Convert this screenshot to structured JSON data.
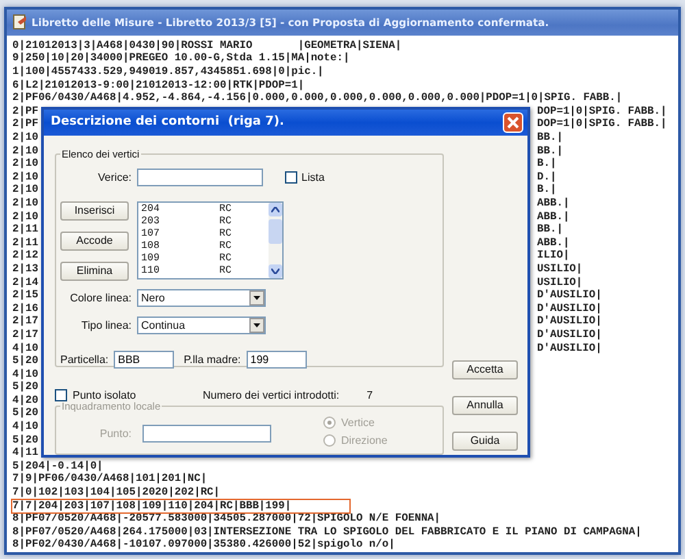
{
  "window": {
    "title": "Libretto delle Misure - Libretto 2013/3 [5] - con Proposta di Aggiornamento confermata."
  },
  "text_lines": [
    {
      "left": "0|21012013|3|A468|0430|90|ROSSI MARIO       |GEOMETRA|SIENA|",
      "highlighted": false
    },
    {
      "left": "9|250|10|20|34000|PREGEO 10.00-G,Stda 1.15|MA|note:|",
      "highlighted": false
    },
    {
      "left": "1|100|4557433.529,949019.857,4345851.698|0|pic.|",
      "highlighted": false
    },
    {
      "left": "6|L2|21012013-9:00|21012013-12:00|RTK|PDOP=1|",
      "highlighted": false
    },
    {
      "left": "2|PF06/0430/A468|4.952,-4.864,-4.156|0.000,0.000,0.000,0.000,0.000,0.000|PDOP=1|0|SPIG. FABB.|",
      "highlighted": false
    },
    {
      "left": "2|PF",
      "right": "DOP=1|0|SPIG. FABB.|",
      "highlighted": false
    },
    {
      "left": "2|PF",
      "right": "DOP=1|0|SPIG. FABB.|",
      "highlighted": false
    },
    {
      "left": "2|10",
      "right": "BB.|",
      "highlighted": false
    },
    {
      "left": "2|10",
      "right": "BB.|",
      "highlighted": false
    },
    {
      "left": "2|10",
      "right": "B.|",
      "highlighted": false
    },
    {
      "left": "2|10",
      "right": "D.|",
      "highlighted": false
    },
    {
      "left": "2|10",
      "right": "B.|",
      "highlighted": false
    },
    {
      "left": "2|10",
      "right": "ABB.|",
      "highlighted": false
    },
    {
      "left": "2|10",
      "right": "ABB.|",
      "highlighted": false
    },
    {
      "left": "2|11",
      "right": "BB.|",
      "highlighted": false
    },
    {
      "left": "2|11",
      "right": "ABB.|",
      "highlighted": false
    },
    {
      "left": "2|12",
      "right": "ILIO|",
      "highlighted": false
    },
    {
      "left": "2|13",
      "right": "USILIO|",
      "highlighted": false
    },
    {
      "left": "2|14",
      "right": "USILIO|",
      "highlighted": false
    },
    {
      "left": "2|15",
      "right": "D'AUSILIO|",
      "highlighted": false
    },
    {
      "left": "2|16",
      "right": "D'AUSILIO|",
      "highlighted": false
    },
    {
      "left": "2|17",
      "right": "D'AUSILIO|",
      "highlighted": false
    },
    {
      "left": "2|17",
      "right": "D'AUSILIO|",
      "highlighted": false
    },
    {
      "left": "4|10",
      "right": "D'AUSILIO|",
      "highlighted": false
    },
    {
      "left": "5|20",
      "highlighted": false
    },
    {
      "left": "4|10",
      "highlighted": false
    },
    {
      "left": "5|20",
      "highlighted": false
    },
    {
      "left": "4|20",
      "highlighted": false
    },
    {
      "left": "5|20",
      "highlighted": false
    },
    {
      "left": "4|10",
      "highlighted": false
    },
    {
      "left": "5|20",
      "highlighted": false
    },
    {
      "left": "4|11",
      "highlighted": false
    },
    {
      "left": "5|204|-0.14|0|",
      "highlighted": false
    },
    {
      "left": "7|9|PF06/0430/A468|101|201|NC|",
      "highlighted": false
    },
    {
      "left": "7|0|102|103|104|105|2020|202|RC|",
      "highlighted": false
    },
    {
      "left": "7|7|204|203|107|108|109|110|204|RC|BBB|199|",
      "highlighted": true
    },
    {
      "left": "8|PF07/0520/A468|-20577.583000|34505.287000|72|SPIGOLO N/E FOENNA|",
      "highlighted": false
    },
    {
      "left": "8|PF07/0520/A468|264.175000|03|INTERSEZIONE TRA LO SPIGOLO DEL FABBRICATO E IL PIANO DI CAMPAGNA|",
      "highlighted": false
    },
    {
      "left": "8|PF02/0430/A468|-10107.097000|35380.426000|52|spigolo n/o|",
      "highlighted": false
    }
  ],
  "dialog": {
    "title": "Descrizione dei contorni  (riga 7).",
    "vertices_group": {
      "legend": "Elenco dei vertici",
      "vertex_label": "Verice:",
      "list_checkbox": {
        "label": "Lista",
        "checked": false
      },
      "buttons": [
        "Inserisci",
        "Accode",
        "Elimina"
      ],
      "vertex_list": [
        {
          "number": "204",
          "code": "RC"
        },
        {
          "number": "203",
          "code": "RC"
        },
        {
          "number": "107",
          "code": "RC"
        },
        {
          "number": "108",
          "code": "RC"
        },
        {
          "number": "109",
          "code": "RC"
        },
        {
          "number": "110",
          "code": "RC"
        }
      ],
      "line_color": {
        "label": "Colore linea:",
        "value": "Nero"
      },
      "line_type": {
        "label": "Tipo linea:",
        "value": "Continua"
      },
      "parcel": {
        "label": "Particella:",
        "value": "BBB"
      },
      "parent_parcel": {
        "label": "P.lla madre:",
        "value": "199"
      }
    },
    "isolated_point": {
      "label": "Punto isolato",
      "checked": false
    },
    "vertex_count": {
      "label": "Numero dei vertici introdotti:",
      "value": "7"
    },
    "local_frame": {
      "legend": "Inquadramento locale",
      "disabled": true,
      "point_label": "Punto:",
      "options": [
        {
          "label": "Vertice",
          "selected": true
        },
        {
          "label": "Direzione",
          "selected": false
        }
      ]
    },
    "buttons": [
      "Accetta",
      "Annulla",
      "Guida"
    ]
  }
}
